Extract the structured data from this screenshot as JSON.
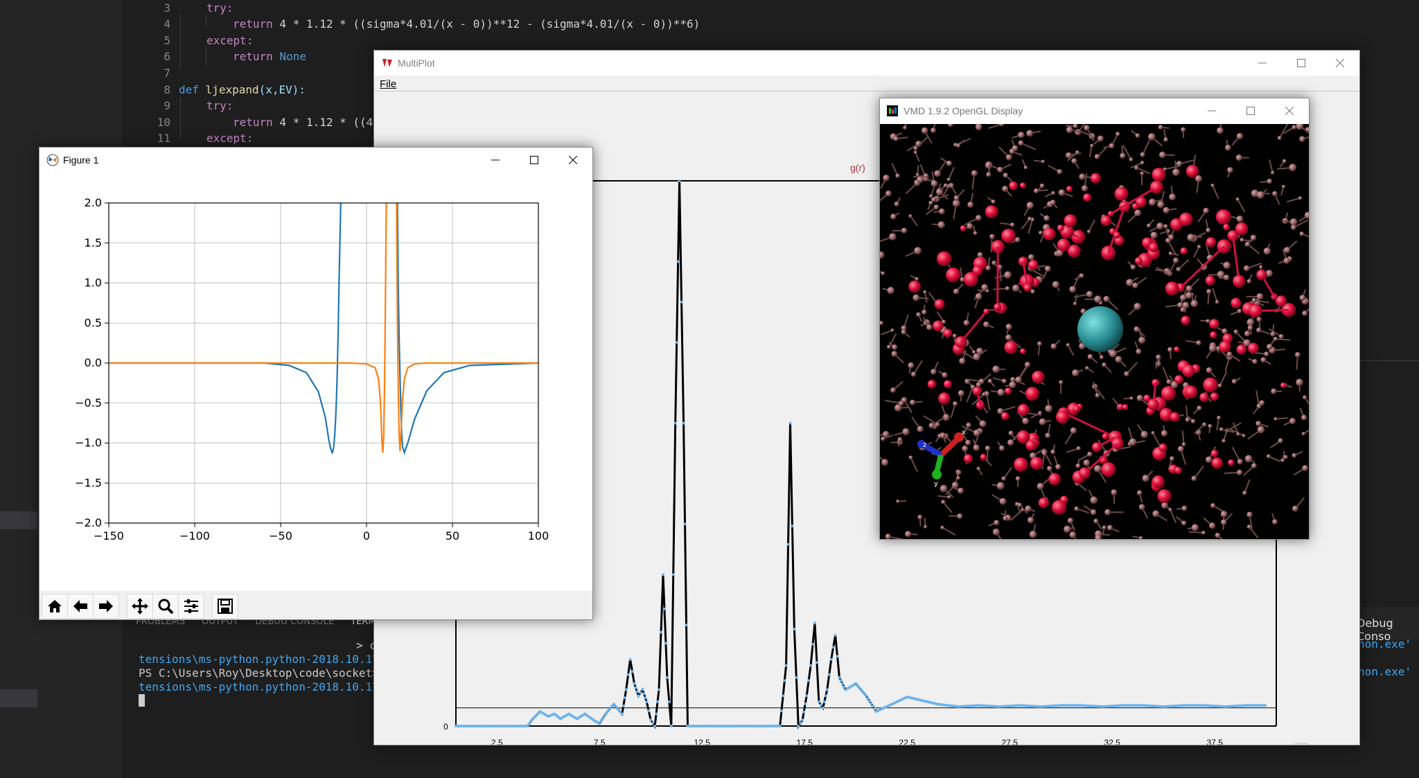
{
  "editor": {
    "line_numbers": [
      "3",
      "4",
      "5",
      "6",
      "7",
      "8",
      "9",
      "10",
      "11"
    ],
    "code": {
      "l3_kw": "try:",
      "l4_kw": "return",
      "l4_rest": " 4 * 1.12 * ((sigma*4.01/(x - 0))**12 - (sigma*4.01/(x - 0))**6)",
      "l5_kw": "except:",
      "l6_kw": "return",
      "l6_val": "None",
      "l8_def": "def",
      "l8_name": "ljexpand",
      "l8_args": "(x,EV):",
      "l9_kw": "try:",
      "l10_kw": "return",
      "l10_rest": " 4 * 1.12 * ((4",
      "l11_kw": "except:"
    },
    "panel_tabs": [
      "PROBLEMS",
      "OUTPUT",
      "DEBUG CONSOLE",
      "TERMI"
    ],
    "terminal_lines": [
      "tensions\\ms-python.python-2018.10.1\\py",
      "PS C:\\Users\\Roy\\Desktop\\code\\socket> c",
      "tensions\\ms-python.python-2018.10.1\\py"
    ],
    "terminal_prompt_fragment": "> c",
    "right_panel_tab": "Debug Conso",
    "right_links": [
      "hon.exe'",
      "hon.exe'"
    ]
  },
  "multiplot": {
    "title": "MultiPlot",
    "menu_file": "File",
    "series_label": "g(r)",
    "y_tick_zero": "0",
    "colors": {
      "black_line": "#000000",
      "blue_points": "#6cb4ee"
    }
  },
  "figure1": {
    "title": "Figure 1",
    "toolbar": [
      "home-icon",
      "back-icon",
      "forward-icon",
      "pan-icon",
      "zoom-icon",
      "configure-icon",
      "save-icon"
    ]
  },
  "vmd": {
    "title": "VMD 1.9.2 OpenGL Display",
    "axes": {
      "x": "x",
      "y": "y",
      "z": "z"
    }
  },
  "chart_data": [
    {
      "type": "line",
      "name": "Figure 1 plot",
      "xlim": [
        -150,
        100
      ],
      "ylim": [
        -2.0,
        2.0
      ],
      "x_ticks": [
        "−150",
        "−100",
        "−50",
        "0",
        "50",
        "100"
      ],
      "y_ticks": [
        "2.0",
        "1.5",
        "1.0",
        "0.5",
        "0.0",
        "−0.5",
        "−1.0",
        "−1.5",
        "−2.0"
      ],
      "grid": true,
      "series": [
        {
          "color": "#1f77b4",
          "x": [
            -150,
            -100,
            -60,
            -45,
            -35,
            -28,
            -24,
            -22,
            -21,
            -20,
            -19.5,
            -19,
            -18.5,
            -18,
            -17.5,
            -17,
            -16.5,
            -16,
            -15,
            -14,
            -13,
            -12,
            -11,
            -10,
            -9,
            -8,
            -7,
            -6,
            -5,
            -4,
            -3,
            -2,
            -1,
            0,
            1,
            2,
            3,
            4,
            5,
            6,
            7,
            8,
            9,
            10,
            11,
            12,
            13,
            14,
            15,
            16,
            17,
            17.5,
            18,
            18.5,
            19,
            19.5,
            20,
            20.5,
            21,
            22,
            24,
            28,
            35,
            45,
            60,
            100
          ],
          "y": [
            0,
            0,
            0,
            -0.03,
            -0.12,
            -0.36,
            -0.68,
            -0.95,
            -1.06,
            -1.12,
            -1.1,
            -1.03,
            -0.9,
            -0.7,
            -0.45,
            -0.1,
            0.4,
            1.0,
            2.5,
            null,
            null,
            null,
            null,
            null,
            null,
            null,
            null,
            null,
            null,
            null,
            null,
            null,
            null,
            null,
            null,
            null,
            null,
            null,
            null,
            null,
            null,
            null,
            null,
            null,
            null,
            null,
            null,
            null,
            null,
            null,
            null,
            null,
            2.5,
            0.9,
            0.3,
            -0.2,
            -0.6,
            -0.9,
            -1.05,
            -1.12,
            -1.0,
            -0.7,
            -0.35,
            -0.12,
            -0.03,
            0
          ]
        },
        {
          "color": "#ff7f0e",
          "x": [
            -150,
            -50,
            -20,
            -10,
            0,
            5,
            7,
            8,
            8.5,
            9,
            9.5,
            10,
            10.5,
            11,
            11.5,
            12,
            13,
            14,
            15,
            16,
            17,
            17.5,
            18,
            18.5,
            19,
            19.5,
            20,
            21,
            22,
            24,
            28,
            35,
            50,
            100
          ],
          "y": [
            0,
            0,
            0,
            0,
            -0.01,
            -0.06,
            -0.2,
            -0.45,
            -0.7,
            -1.0,
            -1.12,
            -0.9,
            -0.3,
            0.8,
            2.5,
            null,
            null,
            null,
            null,
            null,
            null,
            2.5,
            0.5,
            -0.4,
            -0.9,
            -1.1,
            -0.9,
            -0.45,
            -0.2,
            -0.06,
            -0.01,
            0,
            0,
            0
          ]
        }
      ]
    },
    {
      "type": "line",
      "name": "g(r)",
      "x_ticks": [
        "2.5",
        "7.5",
        "12.5",
        "17.5",
        "22.5",
        "27.5",
        "32.5",
        "37.5"
      ],
      "xlim": [
        0.5,
        40.5
      ],
      "ylim": [
        0,
        4.5
      ],
      "reference_line": 0.15,
      "series": [
        {
          "name": "g(r)",
          "color": "#000000",
          "x": [
            0.5,
            4,
            4.2,
            4.6,
            5,
            5.3,
            5.6,
            6,
            6.4,
            6.8,
            7.2,
            7.5,
            7.8,
            8.2,
            8.6,
            8.8,
            9,
            9.2,
            9.4,
            9.6,
            9.8,
            10,
            10.2,
            10.4,
            10.6,
            10.8,
            11,
            11.2,
            11.4,
            11.6,
            11.8,
            12,
            12.5,
            13,
            15,
            16,
            16.3,
            16.6,
            16.8,
            17,
            17.2,
            17.4,
            17.6,
            17.8,
            18,
            18.2,
            18.4,
            18.6,
            18.8,
            19,
            19.2,
            19.5,
            20,
            20.5,
            21,
            21.5,
            22,
            22.5,
            23,
            24,
            25,
            26,
            27,
            28,
            29,
            30,
            31,
            32,
            33,
            34,
            35,
            36,
            37,
            38,
            39,
            40
          ],
          "y": [
            0,
            0,
            0.05,
            0.12,
            0.08,
            0.1,
            0.06,
            0.1,
            0.06,
            0.1,
            0.05,
            0.02,
            0.1,
            0.18,
            0.1,
            0.3,
            0.55,
            0.35,
            0.25,
            0.3,
            0.2,
            0.05,
            0,
            0.3,
            1.25,
            0.4,
            0,
            2.5,
            4.5,
            2.5,
            0,
            0,
            0,
            0,
            0,
            0,
            0,
            0.5,
            2.5,
            0.8,
            0,
            0.05,
            0.25,
            0.5,
            0.85,
            0.2,
            0.15,
            0.3,
            0.55,
            0.75,
            0.4,
            0.3,
            0.35,
            0.25,
            0.12,
            0.16,
            0.2,
            0.24,
            0.22,
            0.18,
            0.16,
            0.17,
            0.16,
            0.17,
            0.16,
            0.17,
            0.17,
            0.16,
            0.17,
            0.17,
            0.16,
            0.17,
            0.17,
            0.16,
            0.17,
            0.17
          ]
        }
      ]
    }
  ]
}
